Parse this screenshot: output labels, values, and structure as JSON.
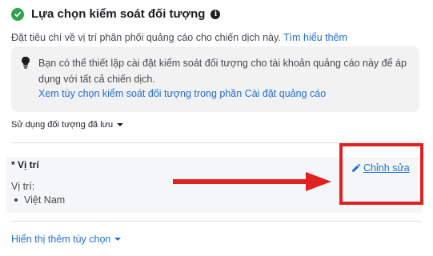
{
  "header": {
    "title": "Lựa chọn kiểm soát đối tượng",
    "info_glyph": "i"
  },
  "subtitle": {
    "text": "Đặt tiêu chí về vị trí phân phối quảng cáo cho chiến dịch này. ",
    "link": "Tìm hiểu thêm"
  },
  "notice": {
    "text": "Bạn có thể thiết lập cài đặt kiểm soát đối tượng cho tài khoản quảng cáo này để áp dụng với tất cả chiến dịch.",
    "link": "Xem tùy chọn kiểm soát đối tượng trong phần Cài đặt quảng cáo"
  },
  "saved_audience": {
    "label": "Sử dụng đối tượng đã lưu"
  },
  "location": {
    "header": "* Vị trí",
    "label": "Vị trí:",
    "items": [
      "Việt Nam"
    ],
    "edit_label": "Chỉnh sửa"
  },
  "more_options": {
    "label": "Hiển thị thêm tùy chọn"
  },
  "icons": {
    "check": "check-circle-icon",
    "info": "info-icon",
    "bulb": "lightbulb-icon",
    "pencil": "pencil-icon",
    "arrow": "red-arrow"
  },
  "colors": {
    "accent": "#216fdb",
    "success": "#31a24c",
    "highlight": "#e02121",
    "panel": "#f2f2f2"
  }
}
